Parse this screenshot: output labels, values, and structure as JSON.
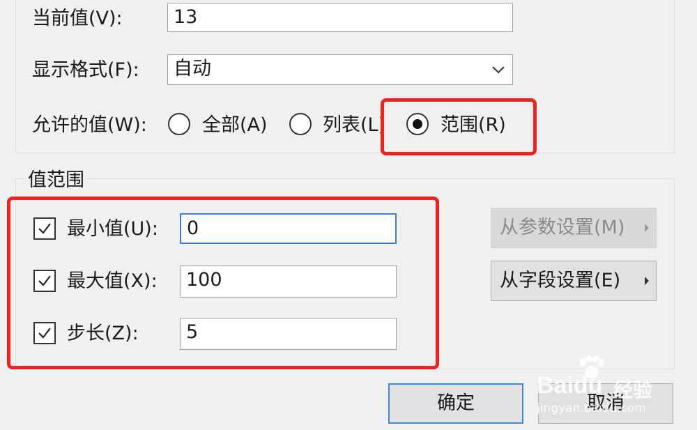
{
  "top_fields": {
    "current_value_label": "当前值(V):",
    "current_value": "13",
    "display_format_label": "显示格式(F):",
    "display_format_value": "自动",
    "allowed_values_label": "允许的值(W):",
    "radio_all": "全部(A)",
    "radio_list": "列表(L)",
    "radio_range": "范围(R)",
    "selected_radio": "范围(R)"
  },
  "value_range": {
    "group_title": "值范围",
    "min_label": "最小值(U):",
    "min_value": "0",
    "min_checked": true,
    "max_label": "最大值(X):",
    "max_value": "100",
    "max_checked": true,
    "step_label": "步长(Z):",
    "step_value": "5",
    "step_checked": true,
    "from_param_button": "从参数设置(M)",
    "from_field_button": "从字段设置(E)"
  },
  "footer": {
    "ok_button": "确定",
    "cancel_button": "取消"
  },
  "watermark": {
    "brand": "Bai",
    "brand_suffix": "du",
    "product": "经验",
    "url": "jingyan.baidu.com"
  },
  "colors": {
    "annotation": "#f02323",
    "focus_border": "#3d7fd1"
  }
}
